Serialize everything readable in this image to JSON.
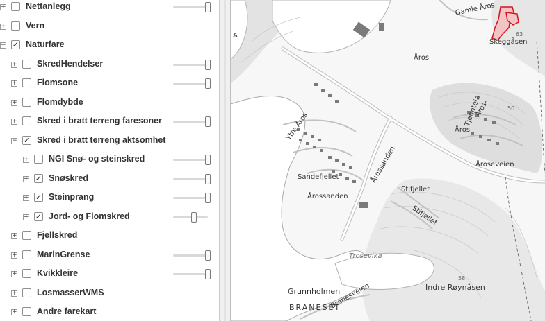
{
  "layers": [
    {
      "label": "Nettanlegg",
      "checked": false,
      "expander": "+",
      "slider": 1.0
    },
    {
      "label": "Vern",
      "checked": false,
      "expander": "+",
      "slider": null
    },
    {
      "label": "Naturfare",
      "checked": true,
      "expander": "−",
      "slider": null
    },
    {
      "label": "SkredHendelser",
      "checked": false,
      "expander": "+",
      "slider": 1.0
    },
    {
      "label": "Flomsone",
      "checked": false,
      "expander": "+",
      "slider": 1.0
    },
    {
      "label": "Flomdybde",
      "checked": false,
      "expander": "+",
      "slider": null
    },
    {
      "label": "Skred i bratt terreng faresoner",
      "checked": false,
      "expander": "+",
      "slider": 1.0
    },
    {
      "label": "Skred i bratt terreng aktsomhet",
      "checked": true,
      "expander": "−",
      "slider": null
    },
    {
      "label": "NGI Snø- og steinskred",
      "checked": false,
      "expander": "+",
      "slider": 1.0
    },
    {
      "label": "Snøskred",
      "checked": true,
      "expander": "+",
      "slider": 1.0
    },
    {
      "label": "Steinprang",
      "checked": true,
      "expander": "+",
      "slider": 1.0
    },
    {
      "label": "Jord- og Flomskred",
      "checked": true,
      "expander": "+",
      "slider": 0.6
    },
    {
      "label": "Fjellskred",
      "checked": false,
      "expander": "+",
      "slider": null
    },
    {
      "label": "MarinGrense",
      "checked": false,
      "expander": "+",
      "slider": 1.0
    },
    {
      "label": "Kvikkleire",
      "checked": false,
      "expander": "+",
      "slider": 1.0
    },
    {
      "label": "LosmasserWMS",
      "checked": false,
      "expander": "+",
      "slider": null
    },
    {
      "label": "Andre farekart",
      "checked": false,
      "expander": "+",
      "slider": null
    }
  ],
  "map": {
    "labels": [
      {
        "text": "Gamle Åros",
        "cls": ""
      },
      {
        "text": "Åros",
        "cls": ""
      },
      {
        "text": "Skeggåsen",
        "cls": ""
      },
      {
        "text": "63",
        "cls": "small"
      },
      {
        "text": "50",
        "cls": "small"
      },
      {
        "text": "Tjønnteia",
        "cls": ""
      },
      {
        "text": "Åros-",
        "cls": ""
      },
      {
        "text": "Åros",
        "cls": ""
      },
      {
        "text": "Åroseveien",
        "cls": ""
      },
      {
        "text": "Ytre Åros",
        "cls": ""
      },
      {
        "text": "Sandefjellet",
        "cls": ""
      },
      {
        "text": "Årossanden",
        "cls": ""
      },
      {
        "text": "Årossanden",
        "cls": ""
      },
      {
        "text": "Stifjellet",
        "cls": ""
      },
      {
        "text": "Stifjellet",
        "cls": ""
      },
      {
        "text": "Trosevika",
        "cls": "italic"
      },
      {
        "text": "58",
        "cls": "small"
      },
      {
        "text": "Indre Røynåsen",
        "cls": "big"
      },
      {
        "text": "Grunnholmen",
        "cls": "big"
      },
      {
        "text": "BRANESET",
        "cls": "big spaced"
      },
      {
        "text": "Branesveien",
        "cls": ""
      },
      {
        "text": "A",
        "cls": ""
      }
    ],
    "colors": {
      "land": "#f7f7f7",
      "water": "#ffffff",
      "road": "#c8c8c8",
      "building": "#7a7a7a",
      "hazard": "#d6141c"
    }
  }
}
